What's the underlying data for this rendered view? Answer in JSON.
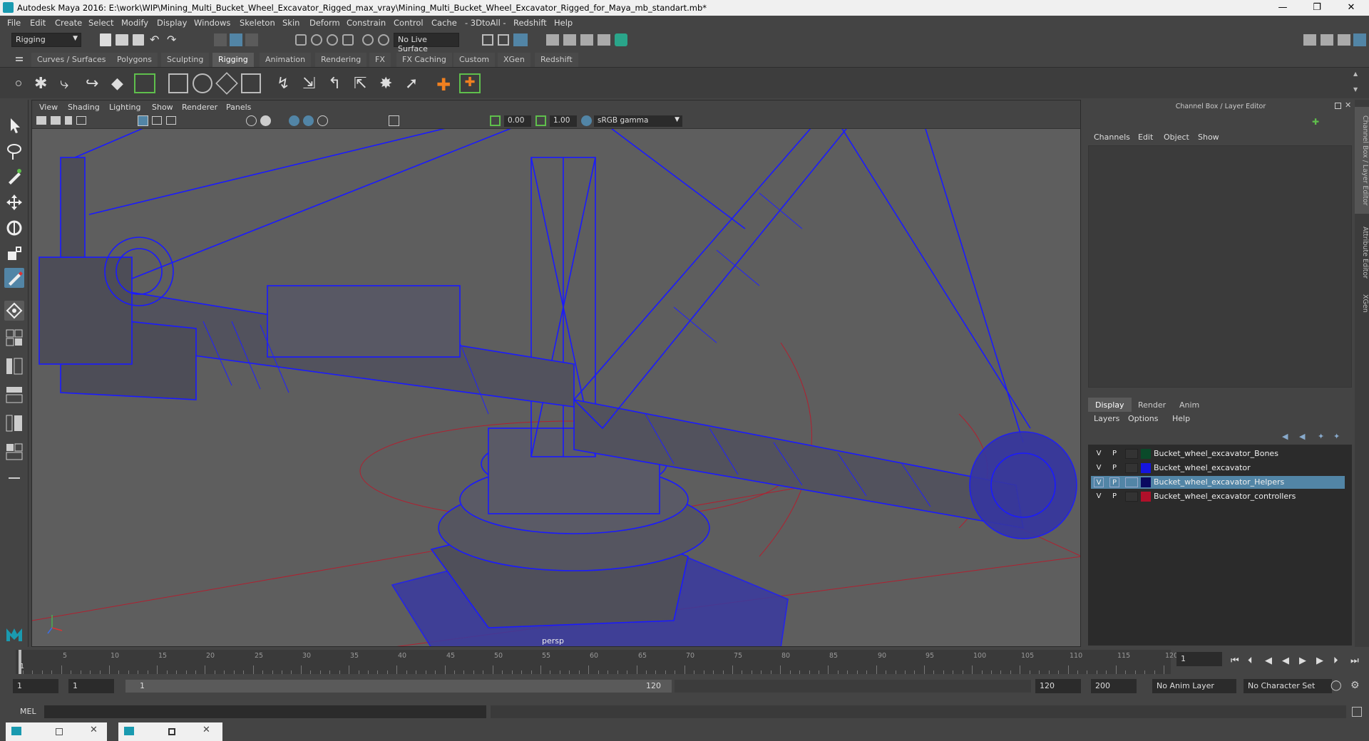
{
  "window": {
    "title": "Autodesk Maya 2016: E:\\work\\WIP\\Mining_Multi_Bucket_Wheel_Excavator_Rigged_max_vray\\Mining_Multi_Bucket_Wheel_Excavator_Rigged_for_Maya_mb_standart.mb*",
    "minimize": "—",
    "maximize": "❐",
    "close": "✕"
  },
  "menubar": [
    "File",
    "Edit",
    "Create",
    "Select",
    "Modify",
    "Display",
    "Windows",
    "Skeleton",
    "Skin",
    "Deform",
    "Constrain",
    "Control",
    "Cache",
    "- 3DtoAll -",
    "Redshift",
    "Help"
  ],
  "statusline": {
    "mode": "Rigging",
    "live_surface": "No Live Surface"
  },
  "shelf_tabs": [
    {
      "label": "Curves / Surfaces",
      "active": false
    },
    {
      "label": "Polygons",
      "active": false
    },
    {
      "label": "Sculpting",
      "active": false
    },
    {
      "label": "Rigging",
      "active": true
    },
    {
      "label": "Animation",
      "active": false
    },
    {
      "label": "Rendering",
      "active": false
    },
    {
      "label": "FX",
      "active": false
    },
    {
      "label": "FX Caching",
      "active": false
    },
    {
      "label": "Custom",
      "active": false
    },
    {
      "label": "XGen",
      "active": false
    },
    {
      "label": "Redshift",
      "active": false
    }
  ],
  "viewport": {
    "menu": [
      "View",
      "Shading",
      "Lighting",
      "Show",
      "Renderer",
      "Panels"
    ],
    "near_value": "0.00",
    "far_value": "1.00",
    "color_space": "sRGB gamma",
    "camera_label": "persp"
  },
  "channel_box": {
    "header": "Channel Box / Layer Editor",
    "menu": [
      "Channels",
      "Edit",
      "Object",
      "Show"
    ]
  },
  "layer_editor": {
    "tabs": [
      {
        "label": "Display",
        "active": true
      },
      {
        "label": "Render",
        "active": false
      },
      {
        "label": "Anim",
        "active": false
      }
    ],
    "menu": [
      "Layers",
      "Options",
      "Help"
    ],
    "layers": [
      {
        "v": "V",
        "p": "P",
        "name": "Bucket_wheel_excavator_Bones",
        "color": "#0a4a2a",
        "selected": false
      },
      {
        "v": "V",
        "p": "P",
        "name": "Bucket_wheel_excavator",
        "color": "#1515e0",
        "selected": false
      },
      {
        "v": "V",
        "p": "P",
        "name": "Bucket_wheel_excavator_Helpers",
        "color": "#0a0a60",
        "selected": true
      },
      {
        "v": "V",
        "p": "P",
        "name": "Bucket_wheel_excavator_controllers",
        "color": "#b0102a",
        "selected": false
      }
    ]
  },
  "side_tabs": [
    "Channel Box / Layer Editor",
    "Attribute Editor",
    "XGen"
  ],
  "timeline": {
    "ticks": [
      "5",
      "10",
      "15",
      "20",
      "25",
      "30",
      "35",
      "40",
      "45",
      "50",
      "55",
      "60",
      "65",
      "70",
      "75",
      "80",
      "85",
      "90",
      "95",
      "100",
      "105",
      "110",
      "115",
      "120"
    ],
    "start_label": "1",
    "current_frame": "1"
  },
  "range": {
    "start": "1",
    "playback_start": "1",
    "slider_start": "1",
    "slider_end": "120",
    "playback_end": "120",
    "end": "200",
    "anim_layer": "No Anim Layer",
    "character_set": "No Character Set"
  },
  "command_line": {
    "label": "MEL"
  }
}
